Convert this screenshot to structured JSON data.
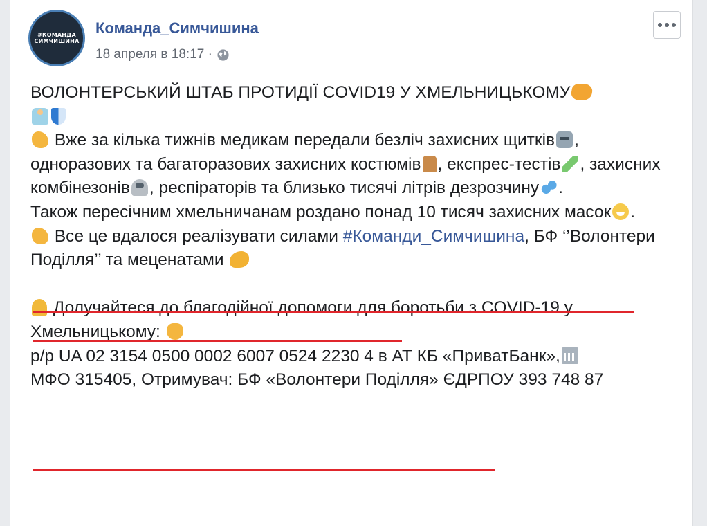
{
  "post": {
    "author": "Команда_Симчишина",
    "avatar_text_line1": "#КОМАНДА",
    "avatar_text_line2": "СИМЧИШИНА",
    "timestamp": "18 апреля в 18:17 ·",
    "privacy_icon": "globe-icon",
    "more_icon": "more-options-icon"
  },
  "body": {
    "headline": "ВОЛОНТЕРСЬКИЙ ШТАБ ПРОТИДІЇ COVID19 У ХМЕЛЬНИЦЬКОМУ",
    "p1": "Вже за кілька тижнів медикам передали безліч захисних щитків",
    "p1b": ", одноразових та багаторазових захисних костюмів",
    "p1c": ", експрес-тестів",
    "p1d": ", захисних комбінезонів",
    "p1e": ", респіраторів та близько тисячі літрів дезрозчину",
    "p1f": ".",
    "p2": "Також пересічним хмельничанам роздано понад 10 тисяч захисних масок",
    "p2b": ".",
    "p3a": "Все це вдалося реалізувати силами",
    "hashtag": "#Команди_Симчишина",
    "p3b": ", БФ ‘’Волонтери Поділля’’ та меценатами",
    "p4": "Долучайтеся до благодійної допомоги для боротьби з COVID-19 у Хмельницькому:",
    "p5a": "р/р UA 02 3154 0500 0002 6007 0524 2230 4 в АТ КБ «ПриватБанк»,",
    "p5b": "МФО 315405, Отримувач: БФ «Волонтери Поділля» ЄДРПОУ 393 748 87"
  },
  "colors": {
    "author_link": "#385898",
    "underline": "#e0262c",
    "meta_text": "#616770"
  }
}
